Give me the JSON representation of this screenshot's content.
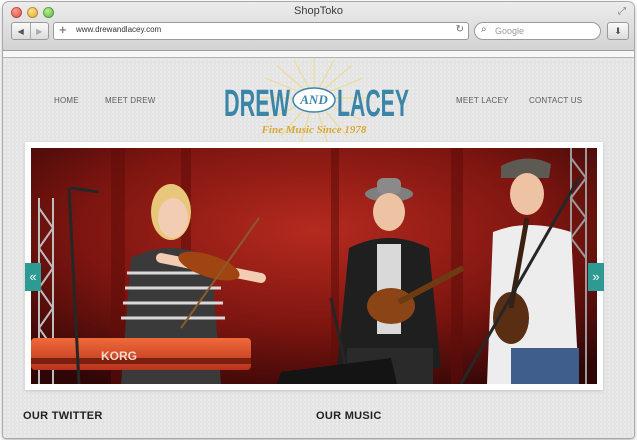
{
  "window": {
    "title": "ShopToko"
  },
  "toolbar": {
    "url": "www.drewandlacey.com",
    "search_placeholder": "Google"
  },
  "site": {
    "nav": {
      "home": "HOME",
      "meet_drew": "MEET DREW",
      "meet_lacey": "MEET LACEY",
      "contact_us": "CONTACT US"
    },
    "logo": {
      "drew": "DREW",
      "and": "AND",
      "lacey": "LACEY",
      "tagline": "Fine Music Since 1978"
    },
    "carousel": {
      "prev_label": "«",
      "next_label": "»",
      "keyboard_brand": "KORG"
    },
    "sections": {
      "twitter": "OUR TWITTER",
      "music": "OUR MUSIC"
    }
  },
  "colors": {
    "brand_blue": "#3b86a8",
    "accent_teal": "#2e9a94",
    "tagline_gold": "#d9a830",
    "stage_red": "#8a1512"
  }
}
